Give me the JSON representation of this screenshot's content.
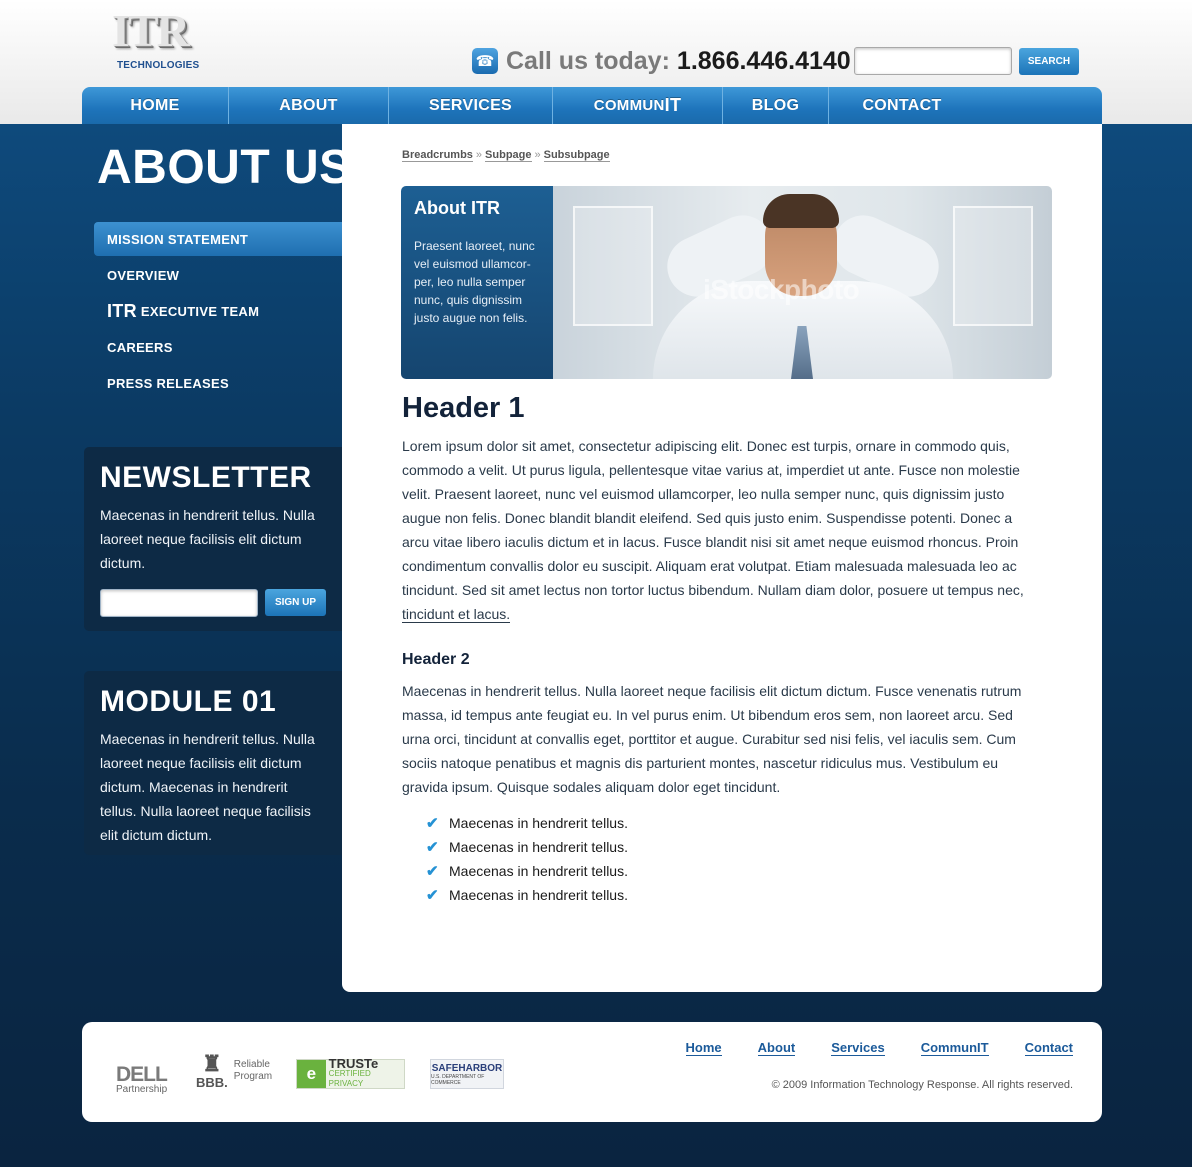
{
  "header": {
    "logo_mark": "ITR",
    "logo_sub": "TECHNOLOGIES",
    "call_label": "Call us today:",
    "phone": "1.866.446.4140",
    "search_placeholder": "",
    "search_button": "SEARCH"
  },
  "nav": {
    "items": [
      "HOME",
      "ABOUT",
      "SERVICES",
      "COMMUN",
      "BLOG",
      "CONTACT"
    ],
    "communit_suffix": "IT"
  },
  "sidebar": {
    "page_title": "ABOUT US",
    "subnav": {
      "mission": "MISSION STATEMENT",
      "overview": "OVERVIEW",
      "exec_big": "ITR",
      "exec_rest": "EXECUTIVE TEAM",
      "careers": "CAREERS",
      "press": "PRESS RELEASES"
    },
    "newsletter": {
      "title": "NEWSLETTER",
      "text": "Maecenas in hendrerit tellus. Nulla laoreet neque facilisis elit dictum dictum.",
      "input_placeholder": "",
      "button": "SIGN UP"
    },
    "module": {
      "title": "MODULE 01",
      "text": "Maecenas in hendrerit tellus. Nulla laoreet neque facilisis elit dictum dictum. Maecenas in hendrerit tellus. Nulla laoreet neque facilisis elit dictum dictum."
    }
  },
  "main": {
    "breadcrumbs": [
      "Breadcrumbs",
      "Subpage",
      "Subsubpage"
    ],
    "breadcrumb_sep": "»",
    "hero": {
      "title": "About ITR",
      "text": "Praesent laoreet, nunc vel euismod ullamcor-per, leo nulla semper nunc, quis dignissim justo augue non felis.",
      "watermark": "iStockphoto"
    },
    "header1": "Header 1",
    "paragraph1": "Lorem ipsum dolor sit amet, consectetur adipiscing elit. Donec est turpis, ornare in commodo quis, commodo a velit. Ut purus ligula, pellentesque vitae varius at, imperdiet ut ante. Fusce non molestie velit. Praesent laoreet, nunc vel euismod ullamcorper, leo nulla semper nunc, quis dignissim justo augue non felis. Donec blandit blandit eleifend. Sed quis justo enim. Suspendisse potenti. Donec a arcu vitae libero iaculis dictum et in lacus. Fusce blandit nisi sit amet neque euismod rhoncus. Proin condimentum convallis dolor eu suscipit. Aliquam erat volutpat. Etiam malesuada malesuada leo ac tincidunt. Sed sit amet lectus non tortor luctus bibendum. Nullam diam dolor, posuere ut tempus nec,",
    "paragraph1_link": "tincidunt et lacus.",
    "header2": "Header 2",
    "paragraph2": "Maecenas in hendrerit tellus. Nulla laoreet neque facilisis elit dictum dictum. Fusce venenatis rutrum massa, id tempus ante feugiat eu. In vel purus enim. Ut bibendum eros sem, non laoreet arcu. Sed urna orci, tincidunt at convallis eget, porttitor et augue. Curabitur sed nisi felis, vel iaculis sem. Cum sociis natoque penatibus et magnis dis parturient montes, nascetur ridiculus mus. Vestibulum eu gravida ipsum. Quisque sodales aliquam dolor eget tincidunt.",
    "checklist": [
      "Maecenas in hendrerit tellus.",
      "Maecenas in hendrerit tellus.",
      "Maecenas in hendrerit tellus.",
      "Maecenas in hendrerit tellus."
    ]
  },
  "footer": {
    "dell_logo": "DELL",
    "dell_label": "Partnership",
    "bbb_mark": "BBB.",
    "bbb_label": "Reliable Program",
    "truste_mark": "TRUSTe",
    "truste_sub": "CERTIFIED PRIVACY",
    "safeharbor_mark": "SAFEHARBOR",
    "safeharbor_sub": "U.S. DEPARTMENT OF COMMERCE",
    "links": [
      "Home",
      "About",
      "Services",
      "CommunIT",
      "Contact"
    ],
    "copyright": "© 2009 Information Technology Response. All rights reserved."
  },
  "colors": {
    "accent_blue": "#1e74bb",
    "dark_navy": "#0d2a45",
    "link_blue": "#1b5a9a",
    "check_blue": "#2592d4"
  },
  "icons": {
    "phone": "phone-icon",
    "check": "check-icon",
    "bbb_torch": "torch-icon"
  }
}
